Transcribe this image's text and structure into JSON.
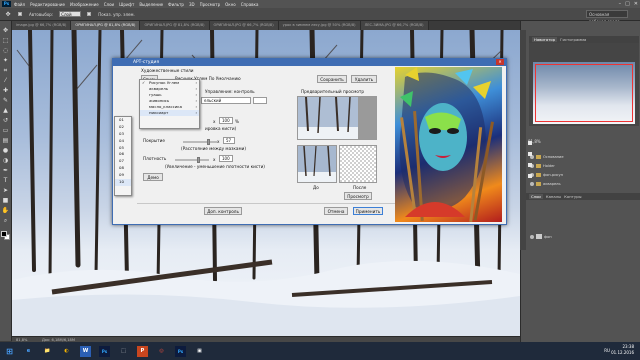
{
  "app": {
    "logo": "Ps",
    "menu": [
      "Файл",
      "Редактирование",
      "Изображение",
      "Слои",
      "Шрифт",
      "Выделение",
      "Фильтр",
      "3D",
      "Просмотр",
      "Окно",
      "Справка"
    ],
    "window_controls": [
      "–",
      "□",
      "✕"
    ]
  },
  "options_bar": {
    "autoselect_label": "Автовыбор:",
    "autoselect_value": "Слой",
    "transform_label": "Показ. упр. элем."
  },
  "workspace": {
    "label": "Основная рабочая среда"
  },
  "tabs": [
    {
      "label": "image.jpg @ 66,7% (RGB/8)",
      "active": false
    },
    {
      "label": "ОРИГИНАЛ.JPG @ 81,8% (RGB/8)",
      "active": true
    },
    {
      "label": "ОРИГИНАЛ.JPG @ 81,8% (RGB/8)",
      "active": false
    },
    {
      "label": "ОРИГИНАЛ.JPG @ 66,7% (RGB/8)",
      "active": false
    },
    {
      "label": "урок в зимнем лесу.jpg @ 50% (RGB/8)",
      "active": false
    },
    {
      "label": "ЛЕС-ЗИМА.JPG @ 66,7% (RGB/8)",
      "active": false
    }
  ],
  "status": {
    "zoom": "81,8%",
    "doc": "Док: 6,18М/6,18М"
  },
  "panels": {
    "nav_tabs": [
      "Навигатор",
      "Гистограмма"
    ],
    "layers_tabs": [
      "Слои",
      "Каналы",
      "Контуры"
    ],
    "layers": [
      {
        "name": "Основание",
        "type": "folder"
      },
      {
        "name": "Holder",
        "type": "folder"
      },
      {
        "name": "фон-рисун",
        "type": "folder"
      },
      {
        "name": "акварель",
        "type": "folder"
      },
      {
        "name": "фон",
        "type": "layer"
      }
    ],
    "zoom": "81,8%"
  },
  "dialog": {
    "title": "АРТ-студия",
    "art_styles_label": "Художественные стили",
    "style_button": "Стиль",
    "style_current": "Рисунок Углем По Умолчанию",
    "save_btn": "Сохранить",
    "delete_btn": "Удалить",
    "control_label": "Управление: контроль",
    "realistic": "ельский",
    "brush_value": "100",
    "brush_caption": "ировка кисти)",
    "coverage_label": "Покрытие",
    "coverage_value": "57",
    "coverage_caption": "(Расстояние между мазками)",
    "density_label": "Плотность",
    "density_value": "100",
    "density_caption": "(Увеличение - уменьшение плотности кисти)",
    "demo_btn": "Демо",
    "additional_btn": "Доп. контроль",
    "cancel_btn": "Отмена",
    "apply_btn": "Применить",
    "preview_label": "Предварительный просмотр",
    "before_label": "До",
    "after_label": "После",
    "preview_btn": "Просмотр",
    "x_label": "x",
    "percent": "%"
  },
  "style_menu": [
    {
      "label": "Рисунок Углем",
      "checked": true,
      "highlight": false
    },
    {
      "label": "акварель",
      "checked": false,
      "highlight": false
    },
    {
      "label": "гуашь",
      "checked": false,
      "highlight": false
    },
    {
      "label": "живопись",
      "checked": false,
      "highlight": false
    },
    {
      "label": "масло_классика",
      "checked": false,
      "highlight": false
    },
    {
      "label": "пиксиарт",
      "checked": false,
      "highlight": true
    }
  ],
  "number_menu": [
    "01",
    "02",
    "03",
    "04",
    "05",
    "06",
    "07",
    "08",
    "09",
    "10"
  ],
  "taskbar": {
    "apps": [
      "⊞",
      "e",
      "📁",
      "◐",
      "W",
      "Ps",
      "⬚",
      "P",
      "◎",
      "Ps",
      "▣"
    ],
    "time": "23:38",
    "date": "01.12.2016",
    "lang": "RU"
  },
  "colors": {
    "accent": "#3f6db3",
    "ps_panel": "#535353",
    "taskbar": "#1f2a3b"
  }
}
